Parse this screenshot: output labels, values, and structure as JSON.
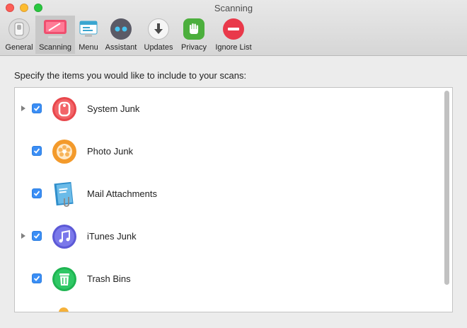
{
  "window": {
    "title": "Scanning"
  },
  "toolbar": {
    "items": [
      {
        "label": "General",
        "icon": "general-switch-icon",
        "selected": false
      },
      {
        "label": "Scanning",
        "icon": "scanning-display-icon",
        "selected": true
      },
      {
        "label": "Menu",
        "icon": "menu-window-icon",
        "selected": false
      },
      {
        "label": "Assistant",
        "icon": "assistant-eyes-icon",
        "selected": false
      },
      {
        "label": "Updates",
        "icon": "download-arrow-icon",
        "selected": false
      },
      {
        "label": "Privacy",
        "icon": "privacy-hand-icon",
        "selected": false
      },
      {
        "label": "Ignore List",
        "icon": "ignore-minus-icon",
        "selected": false
      }
    ]
  },
  "main": {
    "instruction": "Specify the items you would like to include to your scans:",
    "items": [
      {
        "label": "System Junk",
        "checked": true,
        "expandable": true,
        "icon": "system-junk-icon",
        "color": "#e8474c"
      },
      {
        "label": "Photo Junk",
        "checked": true,
        "expandable": false,
        "icon": "photo-junk-icon",
        "color": "#f39a2b"
      },
      {
        "label": "Mail Attachments",
        "checked": true,
        "expandable": false,
        "icon": "mail-attachments-icon",
        "color": "#2f8ecb"
      },
      {
        "label": "iTunes Junk",
        "checked": true,
        "expandable": true,
        "icon": "itunes-junk-icon",
        "color": "#5c59d6"
      },
      {
        "label": "Trash Bins",
        "checked": true,
        "expandable": false,
        "icon": "trash-bins-icon",
        "color": "#1fb552"
      }
    ]
  },
  "colors": {
    "accent": "#3b8ef5",
    "selected_tab": "#c8c8c8"
  }
}
